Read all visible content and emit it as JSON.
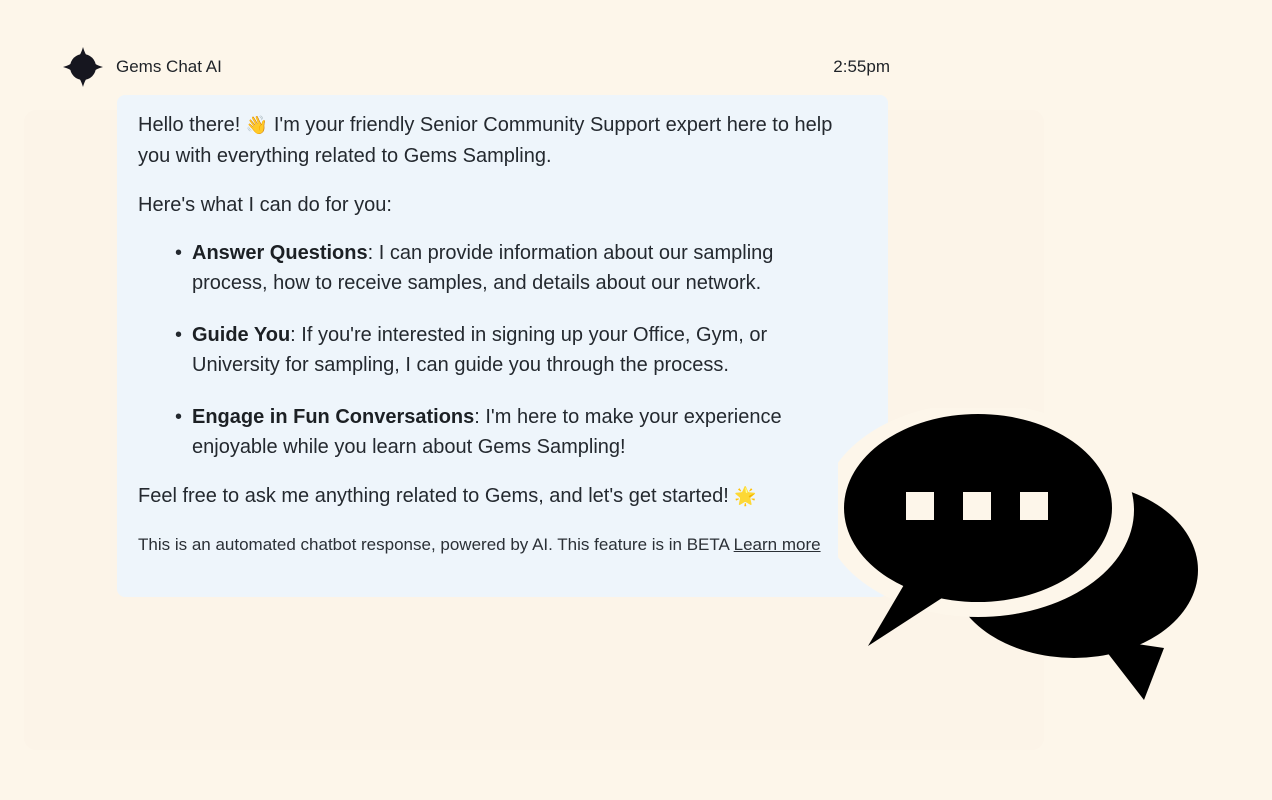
{
  "sender": {
    "name": "Gems Chat AI",
    "time": "2:55pm"
  },
  "message": {
    "greeting_before_emoji": "Hello there! ",
    "wave_emoji": "👋",
    "greeting_after_emoji": " I'm your friendly Senior Community Support expert here to help you with everything related to Gems Sampling.",
    "what_i_do": "Here's what I can do for you:",
    "items": [
      {
        "bold": "Answer Questions",
        "text": ": I can provide information about our sampling process, how to receive samples, and details about our network."
      },
      {
        "bold": "Guide You",
        "text": ": If you're interested in signing up your Office, Gym, or University for sampling, I can guide you through the process."
      },
      {
        "bold": "Engage in Fun Conversations",
        "text": ": I'm here to make your experience enjoyable while you learn about Gems Sampling!"
      }
    ],
    "closing": "Feel free to ask me anything related to Gems, and let's get started! ",
    "sun_emoji": "🌟",
    "disclaimer": "This is an automated chatbot response, powered by AI. This feature is in BETA ",
    "learn_more": "Learn more"
  },
  "icons": {
    "avatar": "diamond-star-icon",
    "chat": "chat-bubbles-icon"
  },
  "colors": {
    "background": "#fdf6ea",
    "bubble": "#eef5fb",
    "avatar": "#16161f",
    "icon": "#000000"
  }
}
